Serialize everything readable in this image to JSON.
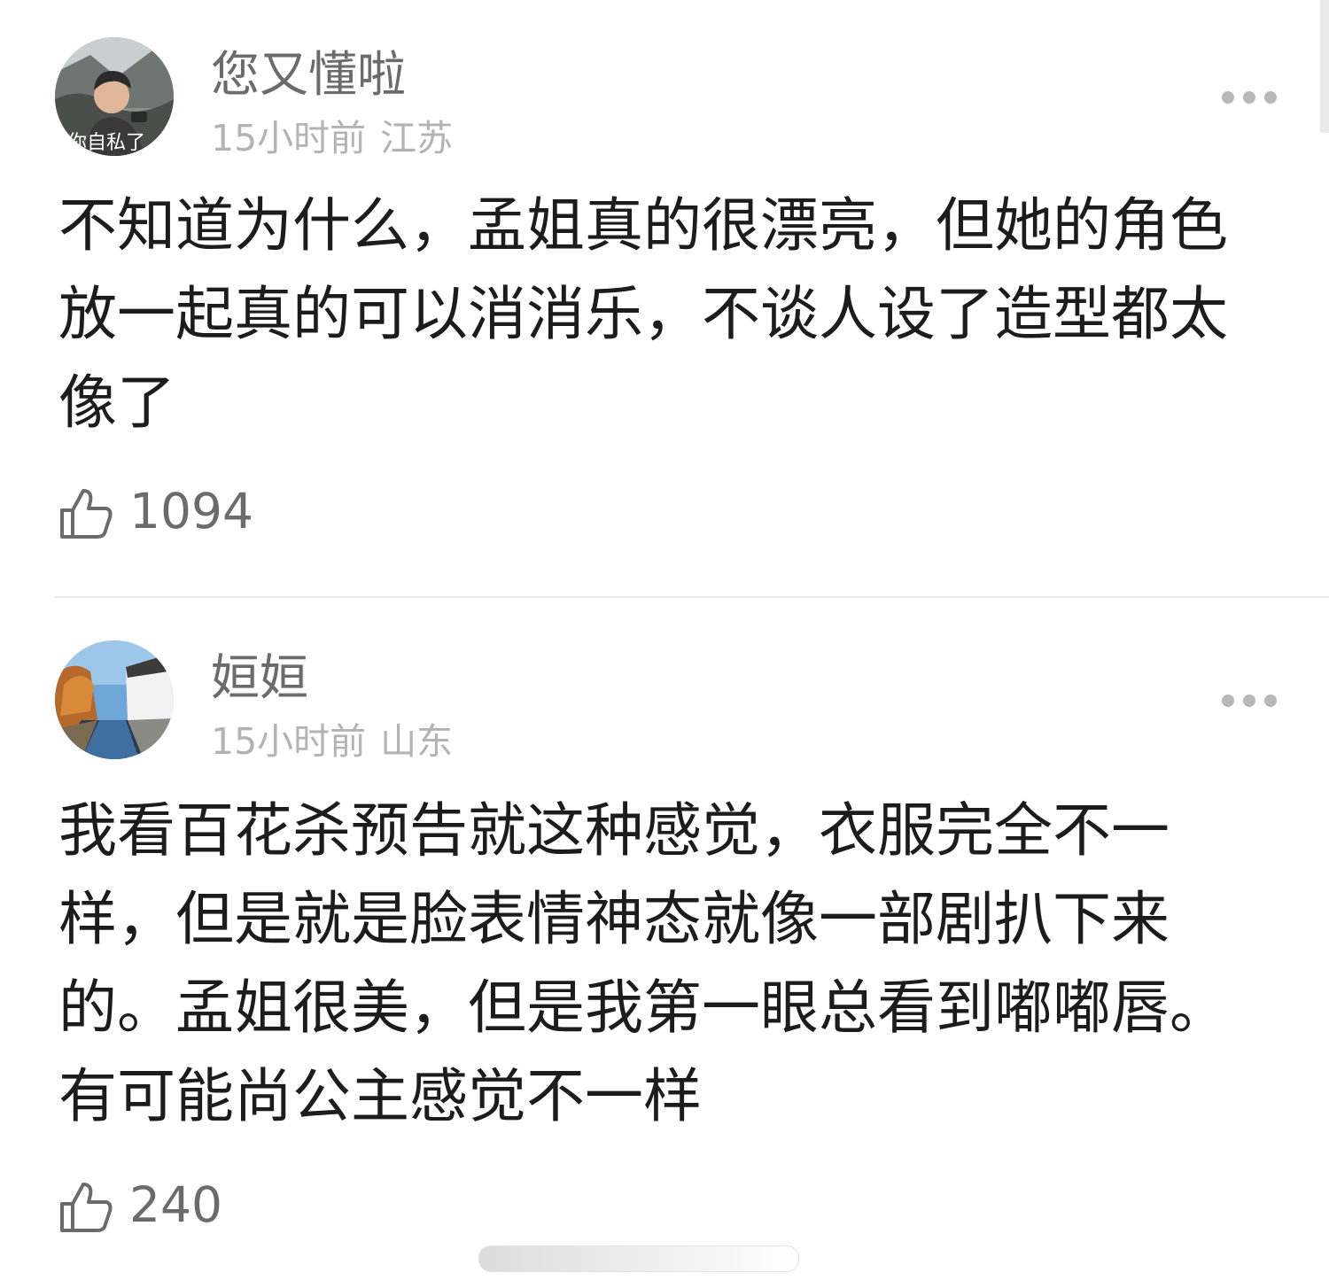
{
  "comments": [
    {
      "username": "您又懂啦",
      "time": "15小时前",
      "location": "江苏",
      "text": "不知道为什么，孟姐真的很漂亮，但她的角色放一起真的可以消消乐，不谈人设了造型都太像了",
      "likes": "1094",
      "avatar_caption": "你自私了"
    },
    {
      "username": "姮姮",
      "time": "15小时前",
      "location": "山东",
      "text": "我看百花杀预告就这种感觉，衣服完全不一样，但是就是脸表情神态就像一部剧扒下来的。孟姐很美，但是我第一眼总看到嘟嘟唇。有可能尚公主感觉不一样",
      "likes": "240"
    }
  ],
  "icons": {
    "more": "more-dots-icon",
    "like": "thumbs-up-icon"
  },
  "colors": {
    "username": "#6b6b6b",
    "meta": "#b3b3b3",
    "text": "#1c1c1c",
    "divider": "#ececec"
  }
}
